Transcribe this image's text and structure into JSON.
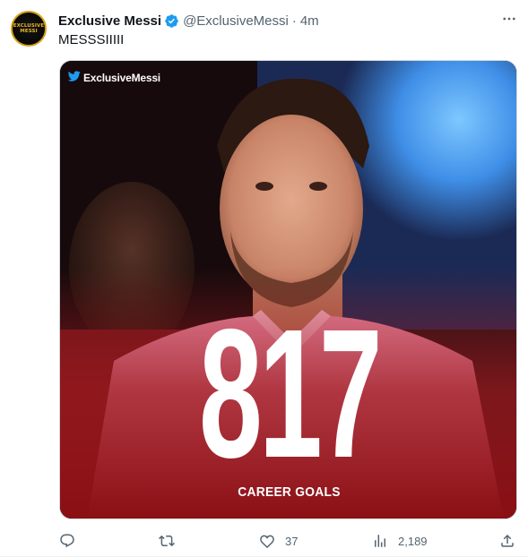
{
  "tweet": {
    "author": {
      "display_name": "Exclusive Messi",
      "handle": "@ExclusiveMessi",
      "verified": true,
      "avatar_text_line1": "EXCLUSIVE",
      "avatar_text_line2": "MESSI"
    },
    "separator": "·",
    "timestamp": "4m",
    "text": "MESSSIIIII",
    "media": {
      "brand_label": "ExclusiveMessi",
      "brand_icon": "twitter-bird-icon",
      "headline_number": "817",
      "caption": "CAREER GOALS"
    },
    "actions": {
      "reply_icon": "reply-icon",
      "retweet_icon": "retweet-icon",
      "like_icon": "heart-icon",
      "like_count": "37",
      "views_icon": "views-icon",
      "views_count": "2,189",
      "share_icon": "share-icon"
    }
  },
  "colors": {
    "text_primary": "#0f1419",
    "text_secondary": "#536471",
    "verified_blue": "#1d9bf0",
    "avatar_gold": "#d4a017",
    "media_red": "#9c1a1f"
  }
}
